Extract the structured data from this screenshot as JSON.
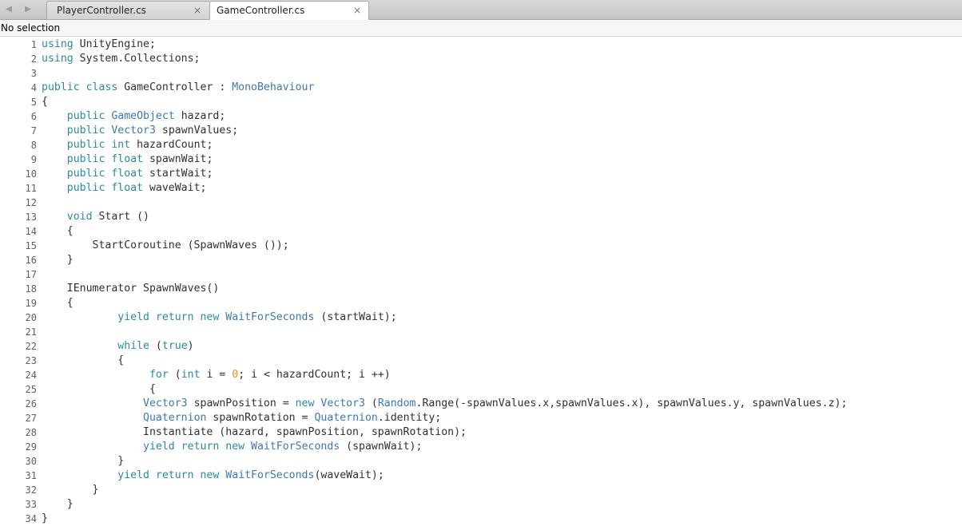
{
  "tabs": {
    "back_glyph": "◀",
    "forward_glyph": "▶",
    "items": [
      {
        "label": "PlayerController.cs",
        "close": "×",
        "active": false
      },
      {
        "label": "GameController.cs",
        "close": "×",
        "active": true
      }
    ]
  },
  "status": {
    "text": "No selection"
  },
  "colors": {
    "keyword": "#2a8aa0",
    "type": "#3c78b4",
    "number": "#e0901e",
    "text": "#303030"
  },
  "code_lines": [
    {
      "n": "1",
      "tokens": [
        [
          "k",
          "using"
        ],
        [
          "t",
          " UnityEngine;"
        ]
      ]
    },
    {
      "n": "2",
      "tokens": [
        [
          "k",
          "using"
        ],
        [
          "t",
          " System.Collections;"
        ]
      ]
    },
    {
      "n": "3",
      "tokens": []
    },
    {
      "n": "4",
      "tokens": [
        [
          "k",
          "public class"
        ],
        [
          "t",
          " GameController : "
        ],
        [
          "y",
          "MonoBehaviour"
        ]
      ]
    },
    {
      "n": "5",
      "tokens": [
        [
          "t",
          "{"
        ]
      ]
    },
    {
      "n": "6",
      "tokens": [
        [
          "t",
          "    "
        ],
        [
          "k",
          "public"
        ],
        [
          "t",
          " "
        ],
        [
          "y",
          "GameObject"
        ],
        [
          "t",
          " hazard;"
        ]
      ]
    },
    {
      "n": "7",
      "tokens": [
        [
          "t",
          "    "
        ],
        [
          "k",
          "public"
        ],
        [
          "t",
          " "
        ],
        [
          "y",
          "Vector3"
        ],
        [
          "t",
          " spawnValues;"
        ]
      ]
    },
    {
      "n": "8",
      "tokens": [
        [
          "t",
          "    "
        ],
        [
          "k",
          "public int"
        ],
        [
          "t",
          " hazardCount;"
        ]
      ]
    },
    {
      "n": "9",
      "tokens": [
        [
          "t",
          "    "
        ],
        [
          "k",
          "public float"
        ],
        [
          "t",
          " spawnWait;"
        ]
      ]
    },
    {
      "n": "10",
      "tokens": [
        [
          "t",
          "    "
        ],
        [
          "k",
          "public float"
        ],
        [
          "t",
          " startWait;"
        ]
      ]
    },
    {
      "n": "11",
      "tokens": [
        [
          "t",
          "    "
        ],
        [
          "k",
          "public float"
        ],
        [
          "t",
          " waveWait;"
        ]
      ]
    },
    {
      "n": "12",
      "tokens": []
    },
    {
      "n": "13",
      "tokens": [
        [
          "t",
          "    "
        ],
        [
          "k",
          "void"
        ],
        [
          "t",
          " Start ()"
        ]
      ]
    },
    {
      "n": "14",
      "tokens": [
        [
          "t",
          "    {"
        ]
      ]
    },
    {
      "n": "15",
      "tokens": [
        [
          "t",
          "        StartCoroutine (SpawnWaves ());"
        ]
      ]
    },
    {
      "n": "16",
      "tokens": [
        [
          "t",
          "    }"
        ]
      ]
    },
    {
      "n": "17",
      "tokens": []
    },
    {
      "n": "18",
      "tokens": [
        [
          "t",
          "    IEnumerator SpawnWaves()"
        ]
      ]
    },
    {
      "n": "19",
      "tokens": [
        [
          "t",
          "    {"
        ]
      ]
    },
    {
      "n": "20",
      "tokens": [
        [
          "t",
          "            "
        ],
        [
          "k",
          "yield return new"
        ],
        [
          "t",
          " "
        ],
        [
          "y",
          "WaitForSeconds"
        ],
        [
          "t",
          " (startWait);"
        ]
      ]
    },
    {
      "n": "21",
      "tokens": []
    },
    {
      "n": "22",
      "tokens": [
        [
          "t",
          "            "
        ],
        [
          "k",
          "while"
        ],
        [
          "t",
          " ("
        ],
        [
          "k",
          "true"
        ],
        [
          "t",
          ")"
        ]
      ]
    },
    {
      "n": "23",
      "tokens": [
        [
          "t",
          "            {"
        ]
      ]
    },
    {
      "n": "24",
      "tokens": [
        [
          "t",
          "                 "
        ],
        [
          "k",
          "for"
        ],
        [
          "t",
          " ("
        ],
        [
          "k",
          "int"
        ],
        [
          "t",
          " i = "
        ],
        [
          "n",
          "0"
        ],
        [
          "t",
          "; i < hazardCount; i ++)"
        ]
      ]
    },
    {
      "n": "25",
      "tokens": [
        [
          "t",
          "                 {"
        ]
      ]
    },
    {
      "n": "26",
      "tokens": [
        [
          "t",
          "                "
        ],
        [
          "y",
          "Vector3"
        ],
        [
          "t",
          " spawnPosition = "
        ],
        [
          "k",
          "new"
        ],
        [
          "t",
          " "
        ],
        [
          "y",
          "Vector3"
        ],
        [
          "t",
          " ("
        ],
        [
          "y",
          "Random"
        ],
        [
          "t",
          ".Range(-spawnValues.x,spawnValues.x), spawnValues.y, spawnValues.z);"
        ]
      ]
    },
    {
      "n": "27",
      "tokens": [
        [
          "t",
          "                "
        ],
        [
          "y",
          "Quaternion"
        ],
        [
          "t",
          " spawnRotation = "
        ],
        [
          "y",
          "Quaternion"
        ],
        [
          "t",
          ".identity;"
        ]
      ]
    },
    {
      "n": "28",
      "tokens": [
        [
          "t",
          "                Instantiate (hazard, spawnPosition, spawnRotation);"
        ]
      ]
    },
    {
      "n": "29",
      "tokens": [
        [
          "t",
          "                "
        ],
        [
          "k",
          "yield return new"
        ],
        [
          "t",
          " "
        ],
        [
          "y",
          "WaitForSeconds"
        ],
        [
          "t",
          " (spawnWait);"
        ]
      ]
    },
    {
      "n": "30",
      "tokens": [
        [
          "t",
          "            }"
        ]
      ]
    },
    {
      "n": "31",
      "tokens": [
        [
          "t",
          "            "
        ],
        [
          "k",
          "yield return new"
        ],
        [
          "t",
          " "
        ],
        [
          "y",
          "WaitForSeconds"
        ],
        [
          "t",
          "(waveWait);"
        ]
      ]
    },
    {
      "n": "32",
      "tokens": [
        [
          "t",
          "        }"
        ]
      ]
    },
    {
      "n": "33",
      "tokens": [
        [
          "t",
          "    }"
        ]
      ]
    },
    {
      "n": "34",
      "tokens": [
        [
          "t",
          "}"
        ]
      ]
    }
  ]
}
